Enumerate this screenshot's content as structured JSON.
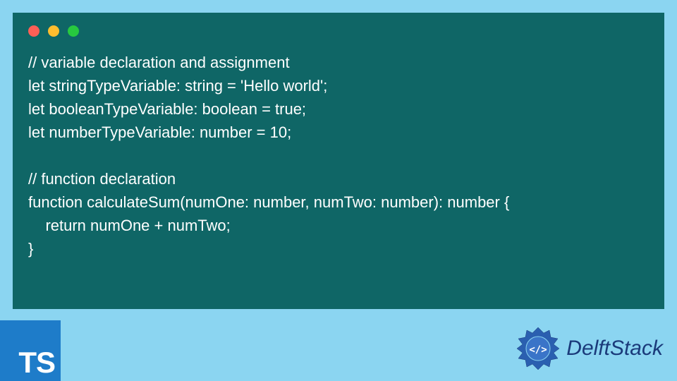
{
  "window": {
    "traffic_lights": [
      "red",
      "yellow",
      "green"
    ]
  },
  "code": {
    "lines": [
      "// variable declaration and assignment",
      "let stringTypeVariable: string = 'Hello world';",
      "let booleanTypeVariable: boolean = true;",
      "let numberTypeVariable: number = 10;",
      "",
      "// function declaration",
      "function calculateSum(numOne: number, numTwo: number): number {",
      "    return numOne + numTwo;",
      "}"
    ]
  },
  "ts_badge": {
    "label": "TS"
  },
  "brand": {
    "name": "DelftStack"
  },
  "colors": {
    "page_bg": "#8bd5f1",
    "code_bg": "#0f6666",
    "code_text": "#ffffff",
    "ts_bg": "#1e7cc9",
    "brand_text": "#1a3a7a",
    "brand_accent": "#2a5fb0"
  }
}
